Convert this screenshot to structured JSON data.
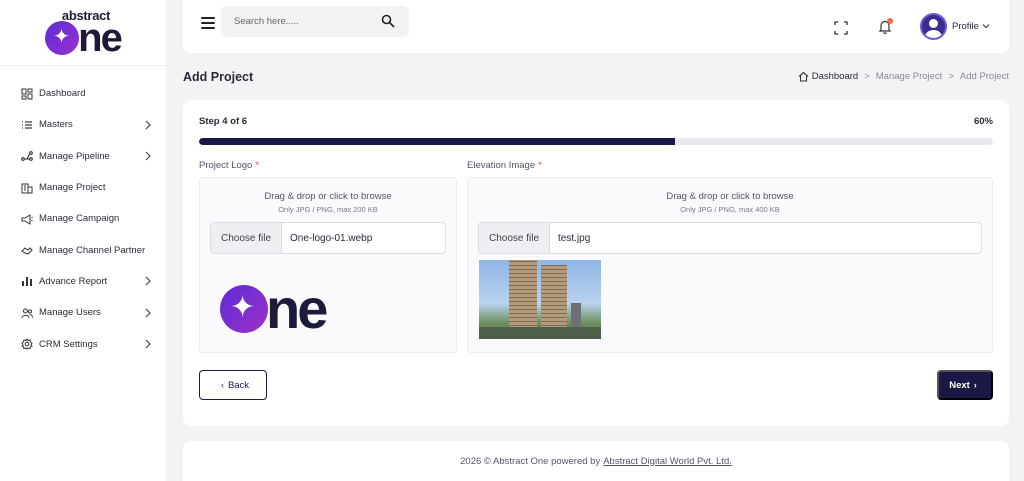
{
  "brand": {
    "line1": "abstract",
    "line2": "ne"
  },
  "sidebar": {
    "items": [
      {
        "label": "Dashboard",
        "icon": "dashboard-icon",
        "has_chevron": false
      },
      {
        "label": "Masters",
        "icon": "list-icon",
        "has_chevron": true
      },
      {
        "label": "Manage Pipeline",
        "icon": "pipeline-icon",
        "has_chevron": true
      },
      {
        "label": "Manage Project",
        "icon": "building-icon",
        "has_chevron": false
      },
      {
        "label": "Manage Campaign",
        "icon": "megaphone-icon",
        "has_chevron": false
      },
      {
        "label": "Manage Channel Partner",
        "icon": "handshake-icon",
        "has_chevron": false
      },
      {
        "label": "Advance Report",
        "icon": "bar-chart-icon",
        "has_chevron": true
      },
      {
        "label": "Manage Users",
        "icon": "users-icon",
        "has_chevron": true
      },
      {
        "label": "CRM Settings",
        "icon": "gear-icon",
        "has_chevron": true
      }
    ]
  },
  "header": {
    "search_placeholder": "Search here.....",
    "profile_label": "Profile"
  },
  "page": {
    "title": "Add Project",
    "breadcrumb": {
      "home": "Dashboard",
      "parent": "Manage Project",
      "current": "Add Project",
      "separator": ">"
    }
  },
  "wizard": {
    "step_label": "Step 4 of 6",
    "progress_percent": 60,
    "progress_text": "60%",
    "project_logo": {
      "label": "Project Logo",
      "required_mark": "*",
      "drop_text": "Drag & drop or click to browse",
      "hint": "Only JPG / PNG, max 200 KB",
      "button_text": "Choose file",
      "file_name": "One-logo-01.webp"
    },
    "elevation_image": {
      "label": "Elevation Image",
      "required_mark": "*",
      "drop_text": "Drag & drop or click to browse",
      "hint": "Only JPG / PNG, max 400 KB",
      "button_text": "Choose file",
      "file_name": "test.jpg"
    },
    "back_label": "Back",
    "next_label": "Next"
  },
  "footer": {
    "text": "2026 © Abstract One powered by",
    "link": "Abstract Digital World Pvt. Ltd."
  },
  "colors": {
    "primary": "#1c1845",
    "required": "#e0443e",
    "notification_dot": "#ff6b3d",
    "brand_gradient_start": "#5b2cd6",
    "brand_gradient_end": "#9b2fd1"
  }
}
